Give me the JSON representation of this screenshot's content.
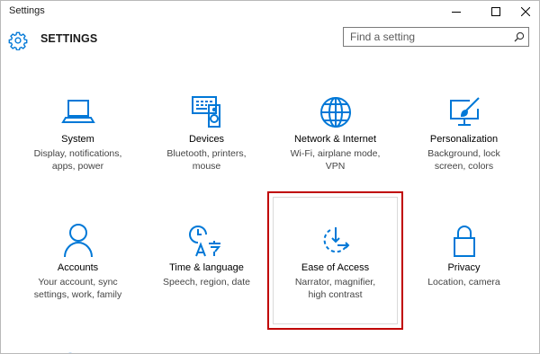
{
  "window": {
    "title": "Settings",
    "controls": {
      "minimize": "minimize-icon",
      "maximize": "maximize-icon",
      "close": "close-icon"
    }
  },
  "header": {
    "icon": "gear-icon",
    "title": "SETTINGS",
    "search": {
      "placeholder": "Find a setting",
      "icon": "search-icon"
    }
  },
  "colors": {
    "accent": "#0078d7",
    "highlight_border": "#c00000"
  },
  "tiles": [
    {
      "icon": "laptop-icon",
      "title": "System",
      "desc": [
        "Display, notifications,",
        "apps, power"
      ]
    },
    {
      "icon": "keyboard-speaker-icon",
      "title": "Devices",
      "desc": [
        "Bluetooth, printers,",
        "mouse"
      ]
    },
    {
      "icon": "globe-icon",
      "title": "Network & Internet",
      "desc": [
        "Wi-Fi, airplane mode,",
        "VPN"
      ]
    },
    {
      "icon": "monitor-brush-icon",
      "title": "Personalization",
      "desc": [
        "Background, lock",
        "screen, colors"
      ]
    },
    {
      "icon": "person-icon",
      "title": "Accounts",
      "desc": [
        "Your account, sync",
        "settings, work, family"
      ]
    },
    {
      "icon": "clock-language-icon",
      "title": "Time & language",
      "desc": [
        "Speech, region, date",
        ""
      ]
    },
    {
      "icon": "ease-of-access-icon",
      "title": "Ease of Access",
      "desc": [
        "Narrator, magnifier,",
        "high contrast"
      ]
    },
    {
      "icon": "lock-icon",
      "title": "Privacy",
      "desc": [
        "Location, camera",
        ""
      ]
    }
  ]
}
